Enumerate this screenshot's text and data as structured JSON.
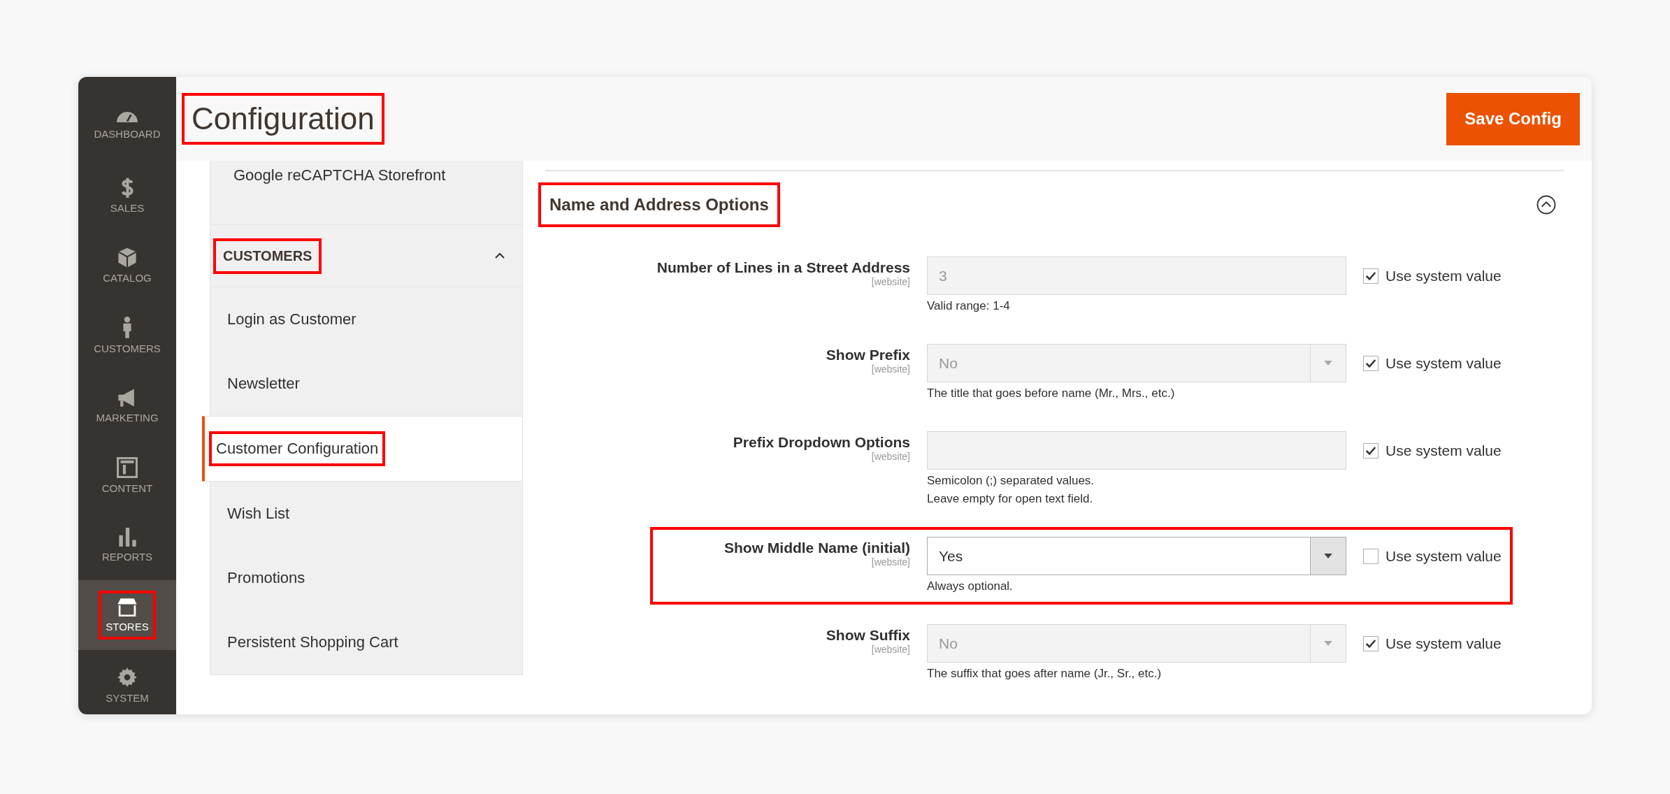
{
  "sidebar": {
    "items": [
      {
        "label": "DASHBOARD",
        "selected": false,
        "highlighted": false
      },
      {
        "label": "SALES",
        "selected": false,
        "highlighted": false
      },
      {
        "label": "CATALOG",
        "selected": false,
        "highlighted": false
      },
      {
        "label": "CUSTOMERS",
        "selected": false,
        "highlighted": false
      },
      {
        "label": "MARKETING",
        "selected": false,
        "highlighted": false
      },
      {
        "label": "CONTENT",
        "selected": false,
        "highlighted": false
      },
      {
        "label": "REPORTS",
        "selected": false,
        "highlighted": false
      },
      {
        "label": "STORES",
        "selected": true,
        "highlighted": true
      },
      {
        "label": "SYSTEM",
        "selected": false,
        "highlighted": false
      }
    ]
  },
  "header": {
    "title": "Configuration",
    "title_highlighted": true,
    "save_button": "Save Config"
  },
  "config_nav": {
    "top_item": "Google reCAPTCHA Storefront",
    "group": {
      "label": "CUSTOMERS",
      "expanded": true,
      "highlighted": true,
      "items": [
        {
          "label": "Login as Customer",
          "selected": false,
          "highlighted": false
        },
        {
          "label": "Newsletter",
          "selected": false,
          "highlighted": false
        },
        {
          "label": "Customer Configuration",
          "selected": true,
          "highlighted": true
        },
        {
          "label": "Wish List",
          "selected": false,
          "highlighted": false
        },
        {
          "label": "Promotions",
          "selected": false,
          "highlighted": false
        },
        {
          "label": "Persistent Shopping Cart",
          "selected": false,
          "highlighted": false
        }
      ]
    }
  },
  "section": {
    "title": "Name and Address Options",
    "title_highlighted": true,
    "expanded": true,
    "fields": [
      {
        "label": "Number of Lines in a Street Address",
        "scope": "[website]",
        "kind": "input",
        "value": "3",
        "disabled": true,
        "use_system_value": "Use system value",
        "checked": true,
        "notes": [
          "Valid range: 1-4"
        ],
        "highlighted": false
      },
      {
        "label": "Show Prefix",
        "scope": "[website]",
        "kind": "select",
        "value": "No",
        "disabled": true,
        "use_system_value": "Use system value",
        "checked": true,
        "notes": [
          "The title that goes before name (Mr., Mrs., etc.)"
        ],
        "highlighted": false
      },
      {
        "label": "Prefix Dropdown Options",
        "scope": "[website]",
        "kind": "input",
        "disabled": true,
        "use_system_value": "Use system value",
        "checked": true,
        "notes": [
          "Semicolon (;) separated values.",
          "Leave empty for open text field."
        ],
        "highlighted": false
      },
      {
        "label": "Show Middle Name (initial)",
        "scope": "[website]",
        "kind": "select",
        "value": "Yes",
        "disabled": false,
        "use_system_value": "Use system value",
        "checked": false,
        "notes": [
          "Always optional."
        ],
        "highlighted": true
      },
      {
        "label": "Show Suffix",
        "scope": "[website]",
        "kind": "select",
        "value": "No",
        "disabled": true,
        "use_system_value": "Use system value",
        "checked": true,
        "notes": [
          "The suffix that goes after name (Jr., Sr., etc.)"
        ],
        "highlighted": false
      }
    ]
  }
}
